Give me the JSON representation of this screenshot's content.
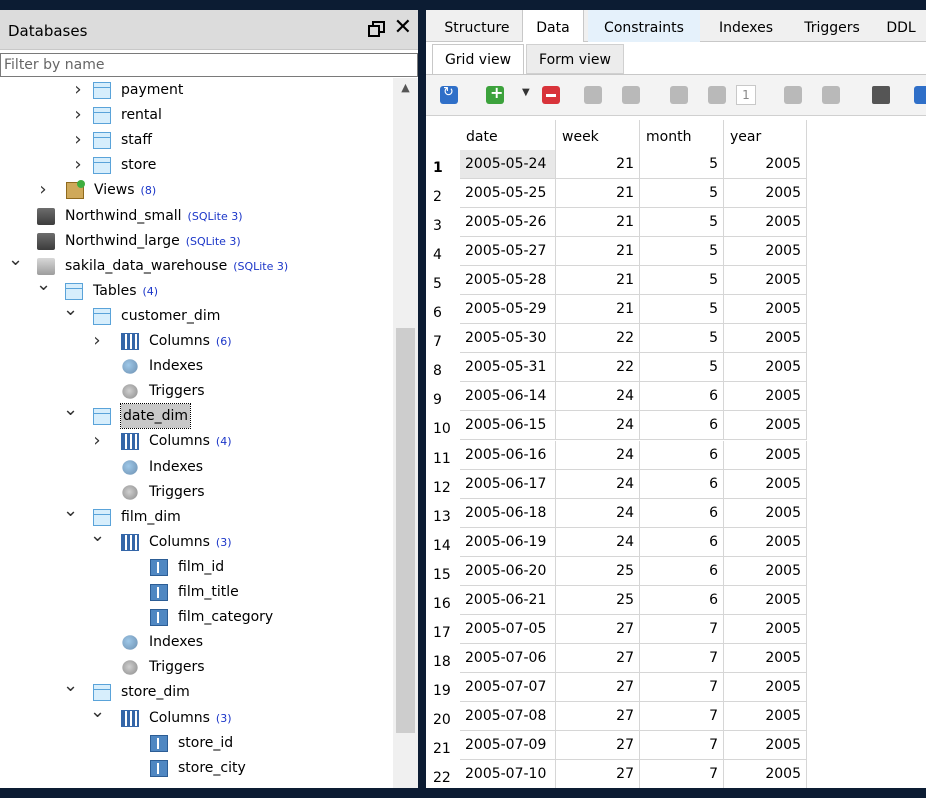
{
  "databases_panel": {
    "title": "Databases",
    "filter_placeholder": "Filter by name"
  },
  "tree": [
    {
      "label": "payment",
      "icon": "table-icon",
      "arrow": ">",
      "count": ""
    },
    {
      "label": "rental",
      "icon": "table-icon",
      "arrow": ">",
      "count": ""
    },
    {
      "label": "staff",
      "icon": "table-icon",
      "arrow": ">",
      "count": ""
    },
    {
      "label": "store",
      "icon": "table-icon",
      "arrow": ">",
      "count": ""
    },
    {
      "label": "Views",
      "icon": "views-icon",
      "arrow": ">",
      "count": "(8)"
    },
    {
      "label": "Northwind_small",
      "icon": "database-icon",
      "arrow": "",
      "count": "(SQLite 3)"
    },
    {
      "label": "Northwind_large",
      "icon": "database-icon",
      "arrow": "",
      "count": "(SQLite 3)"
    },
    {
      "label": "sakila_data_warehouse",
      "icon": "database-open-icon",
      "arrow": "v",
      "count": "(SQLite 3)"
    },
    {
      "label": "Tables",
      "icon": "tables-folder-icon",
      "arrow": "v",
      "count": "(4)"
    },
    {
      "label": "customer_dim",
      "icon": "table-icon",
      "arrow": "v",
      "count": ""
    },
    {
      "label": "Columns",
      "icon": "columns-icon",
      "arrow": ">",
      "count": "(6)"
    },
    {
      "label": "Indexes",
      "icon": "indexes-icon",
      "arrow": "",
      "count": ""
    },
    {
      "label": "Triggers",
      "icon": "triggers-icon",
      "arrow": "",
      "count": ""
    },
    {
      "label": "date_dim",
      "icon": "table-icon",
      "arrow": "v",
      "count": ""
    },
    {
      "label": "Columns",
      "icon": "columns-icon",
      "arrow": ">",
      "count": "(4)"
    },
    {
      "label": "Indexes",
      "icon": "indexes-icon",
      "arrow": "",
      "count": ""
    },
    {
      "label": "Triggers",
      "icon": "triggers-icon",
      "arrow": "",
      "count": ""
    },
    {
      "label": "film_dim",
      "icon": "table-icon",
      "arrow": "v",
      "count": ""
    },
    {
      "label": "Columns",
      "icon": "columns-icon",
      "arrow": "v",
      "count": "(3)"
    },
    {
      "label": "film_id",
      "icon": "column-icon",
      "arrow": "",
      "count": ""
    },
    {
      "label": "film_title",
      "icon": "column-icon",
      "arrow": "",
      "count": ""
    },
    {
      "label": "film_category",
      "icon": "column-icon",
      "arrow": "",
      "count": ""
    },
    {
      "label": "Indexes",
      "icon": "indexes-icon",
      "arrow": "",
      "count": ""
    },
    {
      "label": "Triggers",
      "icon": "triggers-icon",
      "arrow": "",
      "count": ""
    },
    {
      "label": "store_dim",
      "icon": "table-icon",
      "arrow": "v",
      "count": ""
    },
    {
      "label": "Columns",
      "icon": "columns-icon",
      "arrow": "v",
      "count": "(3)"
    },
    {
      "label": "store_id",
      "icon": "column-icon",
      "arrow": "",
      "count": ""
    },
    {
      "label": "store_city",
      "icon": "column-icon",
      "arrow": "",
      "count": ""
    }
  ],
  "selected_tree_item": "date_dim",
  "editor": {
    "tabs": [
      "Structure",
      "Data",
      "Constraints",
      "Indexes",
      "Triggers",
      "DDL"
    ],
    "active_tab": "Data",
    "subtabs": [
      "Grid view",
      "Form view"
    ],
    "active_subtab": "Grid view",
    "page_number": "1"
  },
  "grid": {
    "columns": [
      "date",
      "week",
      "month",
      "year"
    ],
    "rows": [
      {
        "n": "1",
        "date": "2005-05-24",
        "week": "21",
        "month": "5",
        "year": "2005"
      },
      {
        "n": "2",
        "date": "2005-05-25",
        "week": "21",
        "month": "5",
        "year": "2005"
      },
      {
        "n": "3",
        "date": "2005-05-26",
        "week": "21",
        "month": "5",
        "year": "2005"
      },
      {
        "n": "4",
        "date": "2005-05-27",
        "week": "21",
        "month": "5",
        "year": "2005"
      },
      {
        "n": "5",
        "date": "2005-05-28",
        "week": "21",
        "month": "5",
        "year": "2005"
      },
      {
        "n": "6",
        "date": "2005-05-29",
        "week": "21",
        "month": "5",
        "year": "2005"
      },
      {
        "n": "7",
        "date": "2005-05-30",
        "week": "22",
        "month": "5",
        "year": "2005"
      },
      {
        "n": "8",
        "date": "2005-05-31",
        "week": "22",
        "month": "5",
        "year": "2005"
      },
      {
        "n": "9",
        "date": "2005-06-14",
        "week": "24",
        "month": "6",
        "year": "2005"
      },
      {
        "n": "10",
        "date": "2005-06-15",
        "week": "24",
        "month": "6",
        "year": "2005"
      },
      {
        "n": "11",
        "date": "2005-06-16",
        "week": "24",
        "month": "6",
        "year": "2005"
      },
      {
        "n": "12",
        "date": "2005-06-17",
        "week": "24",
        "month": "6",
        "year": "2005"
      },
      {
        "n": "13",
        "date": "2005-06-18",
        "week": "24",
        "month": "6",
        "year": "2005"
      },
      {
        "n": "14",
        "date": "2005-06-19",
        "week": "24",
        "month": "6",
        "year": "2005"
      },
      {
        "n": "15",
        "date": "2005-06-20",
        "week": "25",
        "month": "6",
        "year": "2005"
      },
      {
        "n": "16",
        "date": "2005-06-21",
        "week": "25",
        "month": "6",
        "year": "2005"
      },
      {
        "n": "17",
        "date": "2005-07-05",
        "week": "27",
        "month": "7",
        "year": "2005"
      },
      {
        "n": "18",
        "date": "2005-07-06",
        "week": "27",
        "month": "7",
        "year": "2005"
      },
      {
        "n": "19",
        "date": "2005-07-07",
        "week": "27",
        "month": "7",
        "year": "2005"
      },
      {
        "n": "20",
        "date": "2005-07-08",
        "week": "27",
        "month": "7",
        "year": "2005"
      },
      {
        "n": "21",
        "date": "2005-07-09",
        "week": "27",
        "month": "7",
        "year": "2005"
      },
      {
        "n": "22",
        "date": "2005-07-10",
        "week": "27",
        "month": "7",
        "year": "2005"
      }
    ]
  },
  "colors": {
    "background": "#0c1c33",
    "count_text": "#1a35c8",
    "panel_header": "#dcdcdc"
  }
}
